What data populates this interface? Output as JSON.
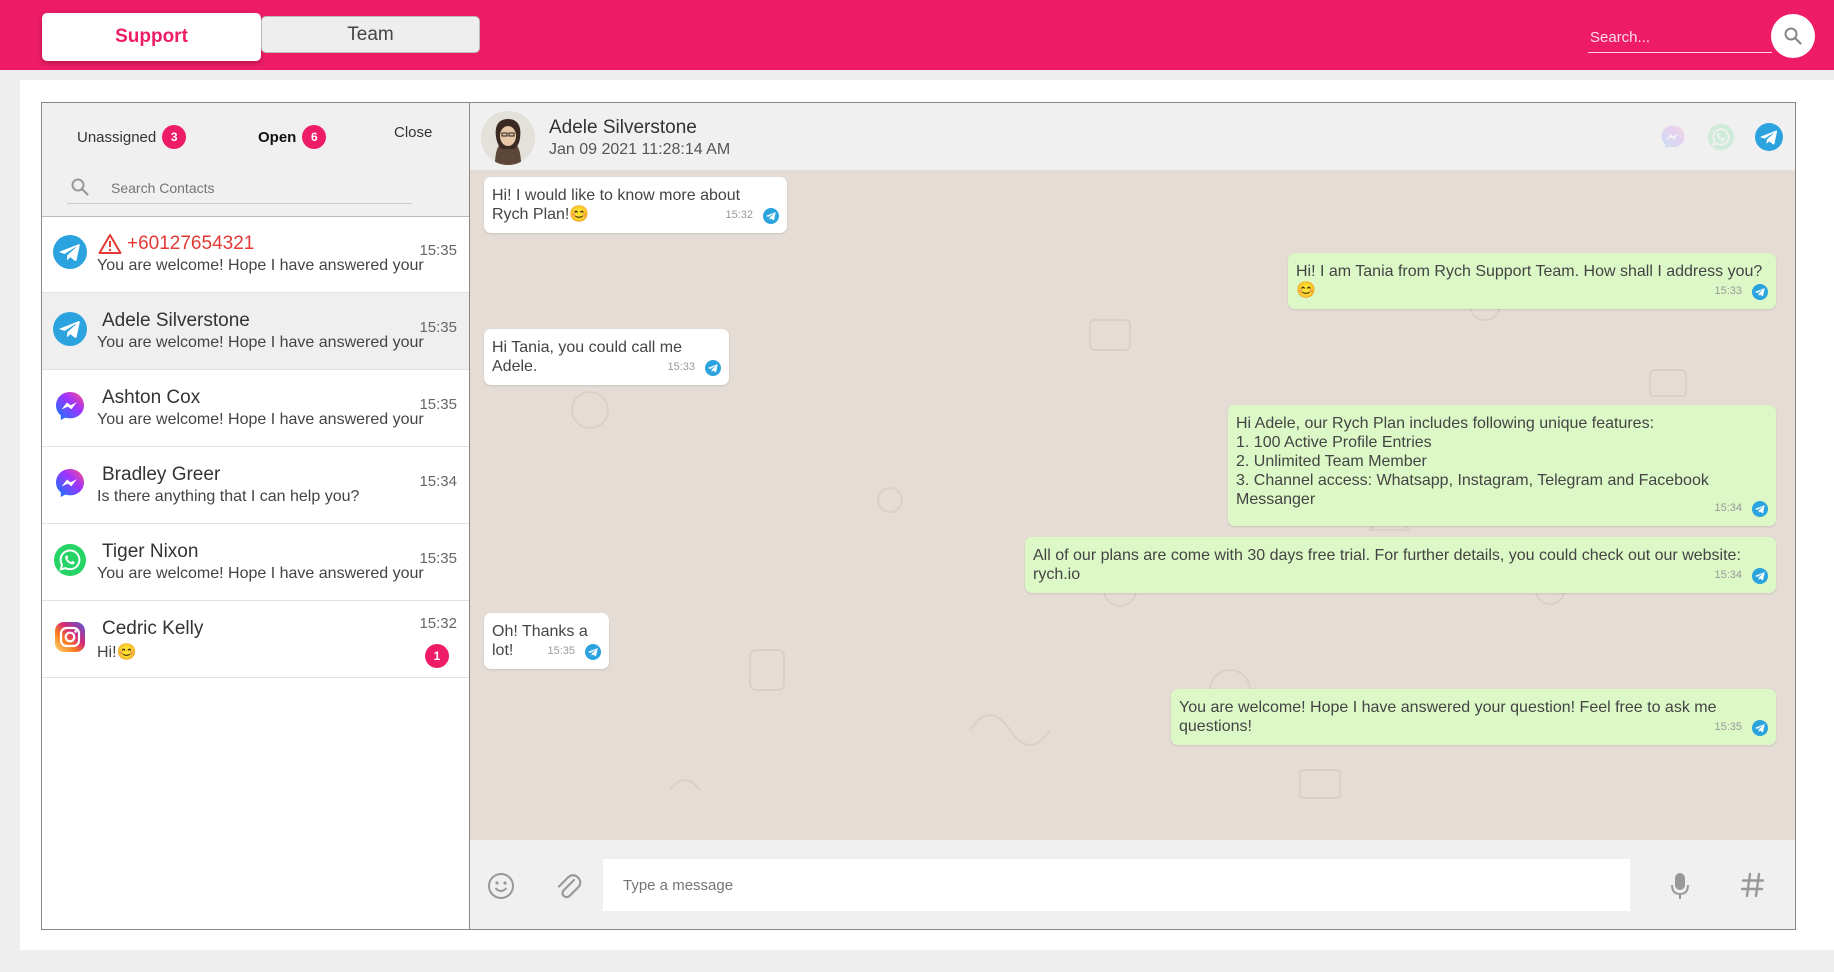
{
  "header": {
    "tabs": [
      {
        "label": "Support"
      },
      {
        "label": "Team"
      }
    ],
    "search_placeholder": "Search..."
  },
  "contacts_panel": {
    "filters": [
      {
        "label": "Unassigned",
        "count": "3"
      },
      {
        "label": "Open",
        "count": "6"
      },
      {
        "label": "Close"
      }
    ],
    "search_placeholder": "Search Contacts",
    "contacts": [
      {
        "name": "+60127654321",
        "channel": "telegram",
        "message": "You are welcome! Hope I have answered your",
        "time": "15:35",
        "alert": true
      },
      {
        "name": "Adele Silverstone",
        "channel": "telegram",
        "message": "You are welcome! Hope I have answered your",
        "time": "15:35",
        "active": true
      },
      {
        "name": "Ashton Cox",
        "channel": "messenger",
        "message": "You are welcome! Hope I have answered your",
        "time": "15:35"
      },
      {
        "name": "Bradley Greer",
        "channel": "messenger",
        "message": "Is there anything that I can help you?",
        "time": "15:34"
      },
      {
        "name": "Tiger Nixon",
        "channel": "whatsapp",
        "message": "You are welcome! Hope I have answered your",
        "time": "15:35"
      },
      {
        "name": "Cedric Kelly",
        "channel": "instagram",
        "message": "Hi!😊",
        "time": "15:32",
        "unread": "1"
      }
    ]
  },
  "chat": {
    "contact_name": "Adele Silverstone",
    "date": "Jan 09 2021 11:28:14 AM",
    "messages": [
      {
        "dir": "in",
        "text": "Hi! I would like to know more about Rych Plan!😊",
        "time": "15:32"
      },
      {
        "dir": "out",
        "text": "Hi! I am Tania from Rych Support Team. How shall I address you?😊",
        "time": "15:33"
      },
      {
        "dir": "in",
        "text": "Hi Tania, you could call me Adele.",
        "time": "15:33"
      },
      {
        "dir": "out",
        "lines": [
          "Hi Adele, our Rych Plan includes following unique features:",
          "1. 100 Active Profile Entries",
          "2. Unlimited Team Member",
          "3. Channel access: Whatsapp, Instagram, Telegram and Facebook Messanger"
        ],
        "time": "15:34"
      },
      {
        "dir": "out",
        "text": "All of our plans are come with 30 days free trial. For further details, you could check out our website: rych.io",
        "time": "15:34"
      },
      {
        "dir": "in",
        "text": "Oh! Thanks a lot!",
        "time": "15:35"
      },
      {
        "dir": "out",
        "text": "You are welcome! Hope I have answered your question! Feel free to ask me questions!",
        "time": "15:35"
      }
    ],
    "input_placeholder": "Type a message"
  },
  "colors": {
    "brand": "#ee1c66",
    "telegram": "#2aa3df",
    "whatsapp": "#25d366",
    "incoming_bubble": "#ffffff",
    "outgoing_bubble": "#dcf8c6"
  },
  "icons": [
    "search-icon",
    "telegram-icon",
    "messenger-icon",
    "whatsapp-icon",
    "instagram-icon",
    "warning-icon",
    "emoji-icon",
    "paperclip-icon",
    "microphone-icon",
    "hashtag-icon"
  ]
}
